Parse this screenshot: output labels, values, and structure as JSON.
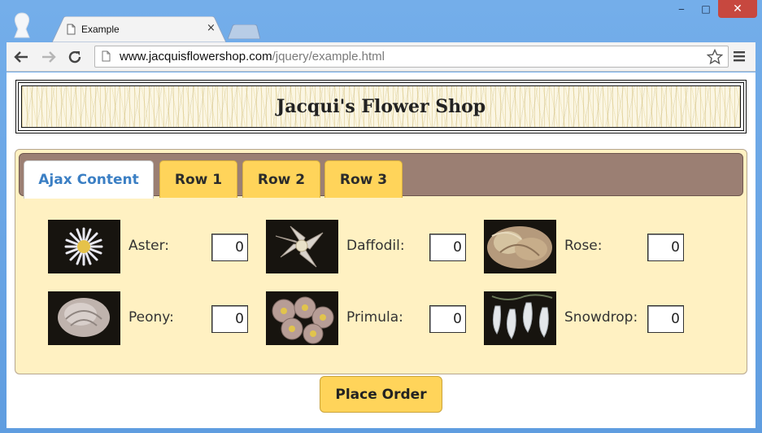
{
  "browser": {
    "tab_title": "Example",
    "tab_close": "×",
    "url_host": "www.jacquisflowershop.com",
    "url_path": "/jquery/example.html",
    "window_controls": {
      "minimize": "‒",
      "maximize": "□",
      "close": "✕"
    }
  },
  "page": {
    "shop_title": "Jacqui's Flower Shop",
    "tabs": [
      {
        "label": "Ajax Content",
        "active": true
      },
      {
        "label": "Row 1"
      },
      {
        "label": "Row 2"
      },
      {
        "label": "Row 3"
      }
    ],
    "products": [
      {
        "name": "Aster:",
        "qty": "0",
        "icon": "aster-image"
      },
      {
        "name": "Daffodil:",
        "qty": "0",
        "icon": "daffodil-image"
      },
      {
        "name": "Rose:",
        "qty": "0",
        "icon": "rose-image"
      },
      {
        "name": "Peony:",
        "qty": "0",
        "icon": "peony-image"
      },
      {
        "name": "Primula:",
        "qty": "0",
        "icon": "primula-image"
      },
      {
        "name": "Snowdrop:",
        "qty": "0",
        "icon": "snowdrop-image"
      }
    ],
    "order_button": "Place Order"
  },
  "colors": {
    "tab_bar": "#9b7f73",
    "tab_yellow": "#ffd45a",
    "active_tab_text": "#3b7fc4",
    "panel_bg": "#fff1c2"
  }
}
